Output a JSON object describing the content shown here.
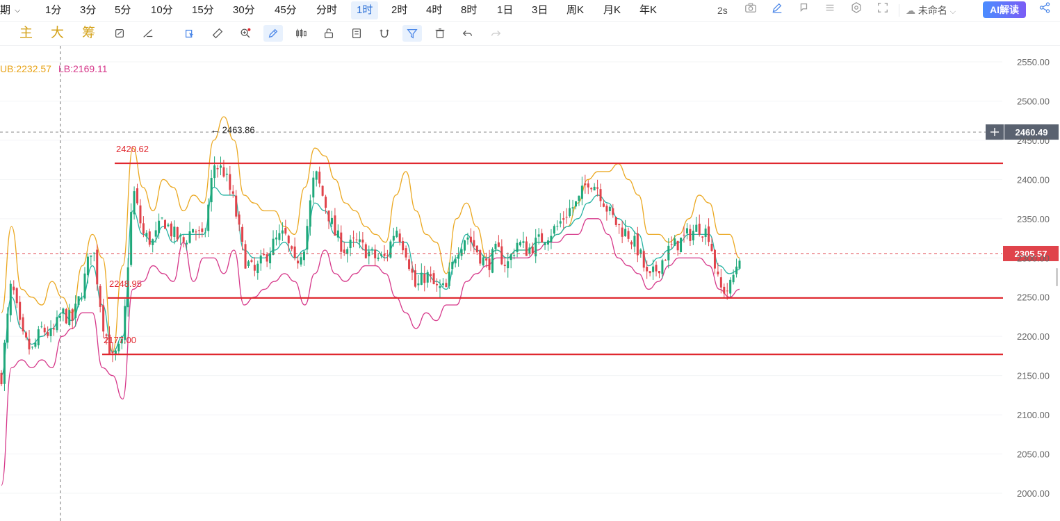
{
  "topbar": {
    "cut_label": "期",
    "periods": [
      "1分",
      "3分",
      "5分",
      "10分",
      "15分",
      "30分",
      "45分",
      "分时",
      "1时",
      "2时",
      "4时",
      "8时",
      "1日",
      "3日",
      "周K",
      "月K",
      "年K"
    ],
    "active_period": "1时",
    "refresh": "2s",
    "layout_name": "未命名",
    "ai_label": "AI解读"
  },
  "toolbar": {
    "indicators": [
      "主",
      "大",
      "筹"
    ]
  },
  "boll": {
    "ub_label": "UB:2232.57",
    "lb_label": "LB:2169.11",
    "ub_color": "#e8a317",
    "lb_color": "#d6388a"
  },
  "chart_data": {
    "type": "candlestick",
    "y_axis_ticks": [
      "2550.00",
      "2500.00",
      "2450.00",
      "2400.00",
      "2350.00",
      "2300.00",
      "2250.00",
      "2200.00",
      "2150.00",
      "2100.00",
      "2050.00",
      "2000.00"
    ],
    "ylim": [
      2000,
      2550
    ],
    "crosshair_price": "2460.49",
    "last_price": "2305.57",
    "last_price_value": 2305.57,
    "high_marker": "2463.86",
    "high_value": 2463.86,
    "levels": [
      {
        "label": "2420.62",
        "value": 2420.62
      },
      {
        "label": "2248.95",
        "value": 2248.95
      },
      {
        "label": "2177.00",
        "value": 2177.0
      }
    ],
    "upper_band": [
      2230,
      2340,
      2260,
      2250,
      2240,
      2270,
      2250,
      2230,
      2290,
      2330,
      2300,
      2180,
      2290,
      2440,
      2390,
      2360,
      2400,
      2390,
      2360,
      2380,
      2370,
      2450,
      2480,
      2450,
      2380,
      2370,
      2360,
      2360,
      2340,
      2330,
      2390,
      2440,
      2430,
      2400,
      2370,
      2360,
      2340,
      2330,
      2320,
      2380,
      2410,
      2360,
      2330,
      2320,
      2280,
      2350,
      2370,
      2340,
      2300,
      2310,
      2300,
      2310,
      2310,
      2320,
      2320,
      2330,
      2340,
      2370,
      2400,
      2410,
      2410,
      2420,
      2400,
      2380,
      2330,
      2330,
      2320,
      2330,
      2350,
      2380,
      2370,
      2330,
      2330,
      2300
    ],
    "lower_band": [
      2010,
      2160,
      2170,
      2160,
      2170,
      2160,
      2200,
      2210,
      2230,
      2230,
      2160,
      2150,
      2120,
      2260,
      2270,
      2290,
      2280,
      2270,
      2320,
      2270,
      2300,
      2300,
      2280,
      2310,
      2240,
      2250,
      2260,
      2270,
      2280,
      2270,
      2240,
      2280,
      2310,
      2280,
      2270,
      2280,
      2290,
      2290,
      2280,
      2250,
      2230,
      2210,
      2230,
      2220,
      2240,
      2240,
      2270,
      2280,
      2290,
      2300,
      2300,
      2300,
      2300,
      2310,
      2320,
      2320,
      2330,
      2330,
      2350,
      2350,
      2330,
      2300,
      2290,
      2280,
      2260,
      2270,
      2290,
      2300,
      2300,
      2300,
      2290,
      2260,
      2250,
      2260
    ],
    "middle_band": [
      2150,
      2250,
      2210,
      2190,
      2200,
      2210,
      2230,
      2220,
      2250,
      2290,
      2240,
      2180,
      2200,
      2360,
      2330,
      2320,
      2340,
      2320,
      2330,
      2330,
      2330,
      2390,
      2380,
      2380,
      2310,
      2300,
      2300,
      2310,
      2320,
      2300,
      2310,
      2370,
      2360,
      2330,
      2320,
      2320,
      2310,
      2310,
      2300,
      2320,
      2320,
      2280,
      2280,
      2270,
      2260,
      2300,
      2330,
      2310,
      2300,
      2310,
      2300,
      2310,
      2310,
      2320,
      2320,
      2330,
      2340,
      2350,
      2370,
      2380,
      2370,
      2350,
      2340,
      2330,
      2290,
      2300,
      2310,
      2320,
      2330,
      2330,
      2330,
      2290,
      2280,
      2285
    ],
    "close_path": [
      2150,
      2270,
      2200,
      2180,
      2210,
      2200,
      2230,
      2220,
      2260,
      2320,
      2220,
      2170,
      2190,
      2390,
      2330,
      2320,
      2350,
      2330,
      2320,
      2340,
      2320,
      2420,
      2410,
      2370,
      2300,
      2280,
      2300,
      2320,
      2330,
      2290,
      2320,
      2410,
      2370,
      2330,
      2310,
      2320,
      2310,
      2300,
      2300,
      2340,
      2310,
      2260,
      2280,
      2260,
      2260,
      2310,
      2330,
      2310,
      2290,
      2310,
      2290,
      2320,
      2310,
      2320,
      2330,
      2340,
      2360,
      2370,
      2400,
      2390,
      2360,
      2340,
      2330,
      2310,
      2270,
      2290,
      2310,
      2320,
      2330,
      2340,
      2330,
      2260,
      2260,
      2305
    ]
  }
}
